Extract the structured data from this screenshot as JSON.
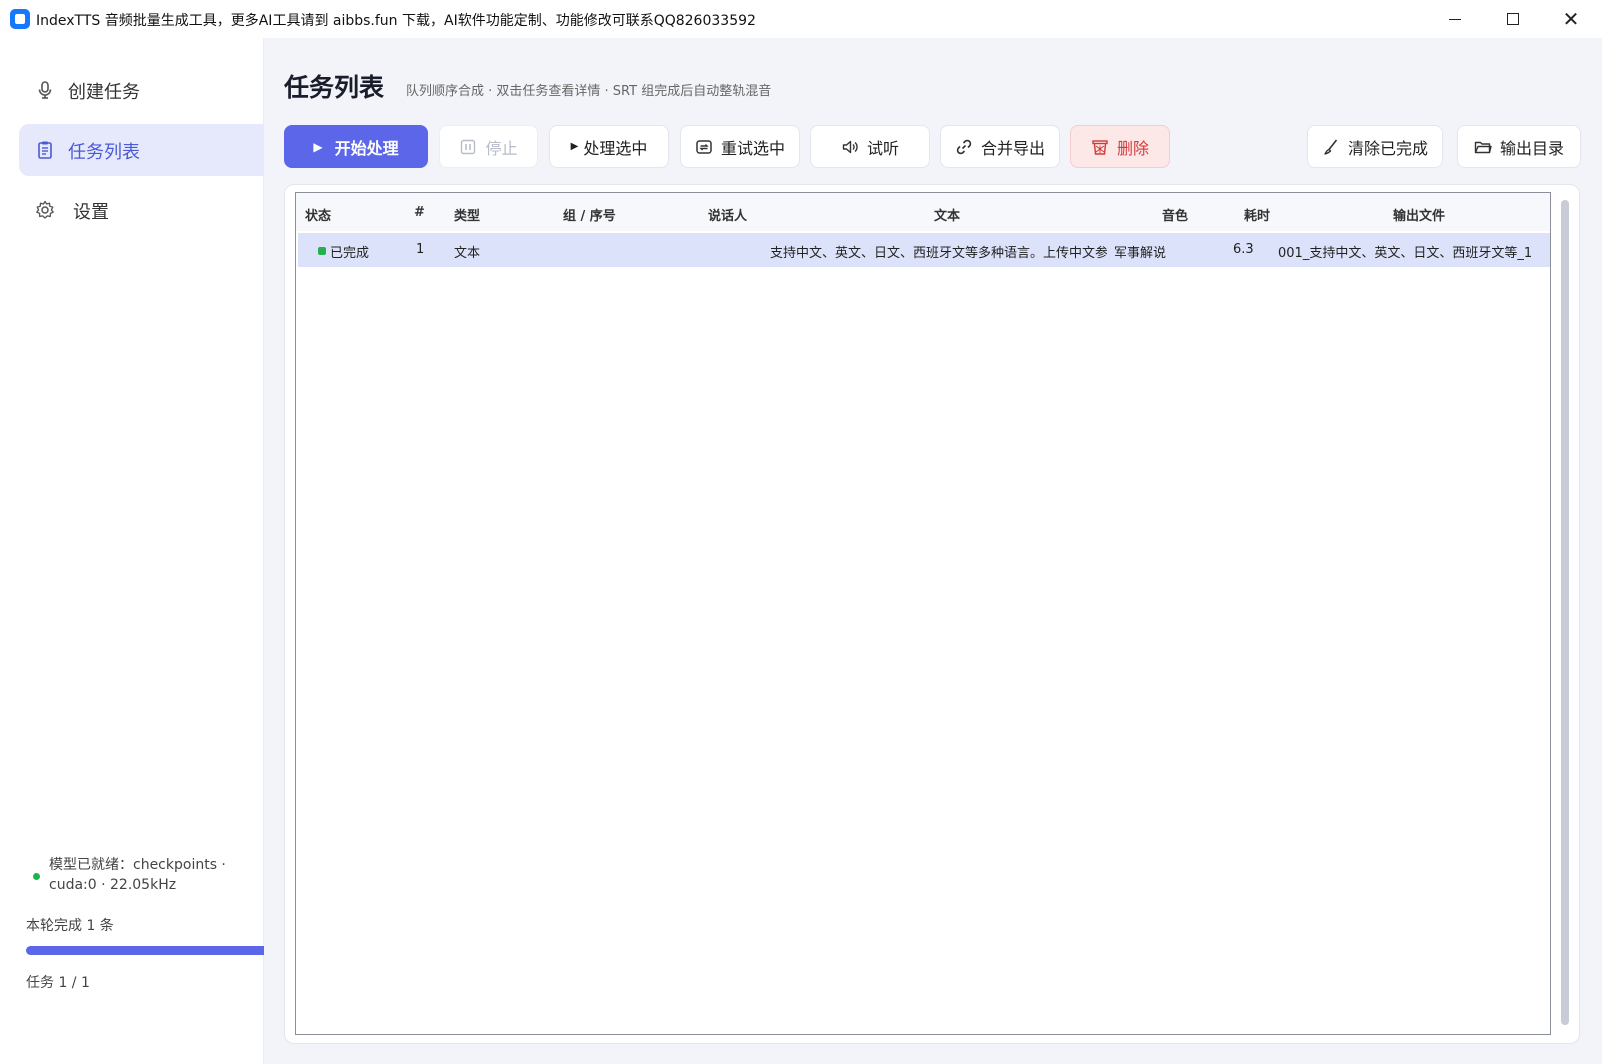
{
  "window": {
    "title": "IndexTTS 音频批量生成工具，更多AI工具请到 aibbs.fun 下载，AI软件功能定制、功能修改可联系QQ826033592"
  },
  "sidebar": {
    "items": [
      {
        "label": "创建任务",
        "icon": "microphone-icon"
      },
      {
        "label": "任务列表",
        "icon": "clipboard-icon"
      },
      {
        "label": "设置",
        "icon": "gear-icon"
      }
    ],
    "model_status": "模型已就绪：checkpoints · cuda:0 · 22.05kHz",
    "round_text": "本轮完成 1 条",
    "progress_fraction": 1.0,
    "task_count": "任务 1 / 1"
  },
  "header": {
    "title": "任务列表",
    "subtitle": "队列顺序合成 · 双击任务查看详情 · SRT 组完成后自动整轨混音"
  },
  "toolbar": {
    "start": "开始处理",
    "stop": "停止",
    "process_selected": "处理选中",
    "retry_selected": "重试选中",
    "listen": "试听",
    "merge_export": "合并导出",
    "delete": "删除",
    "clear_completed": "清除已完成",
    "output_dir": "输出目录"
  },
  "table": {
    "columns": [
      "状态",
      "#",
      "类型",
      "组 / 序号",
      "说话人",
      "文本",
      "音色",
      "耗时",
      "输出文件"
    ],
    "rows": [
      {
        "status": "已完成",
        "index": "1",
        "type": "文本",
        "group": "",
        "speaker": "",
        "text": "支持中文、英文、日文、西班牙文等多种语言。上传中文参考",
        "voice": "军事解说",
        "duration": "6.3",
        "output": "001_支持中文、英文、日文、西班牙文等_1"
      }
    ]
  },
  "colors": {
    "accent": "#5b67e8",
    "active_nav_bg": "#e6e9fb",
    "delete_bg": "#fde8e8",
    "delete_text": "#d13a3a",
    "success": "#22b14c"
  }
}
